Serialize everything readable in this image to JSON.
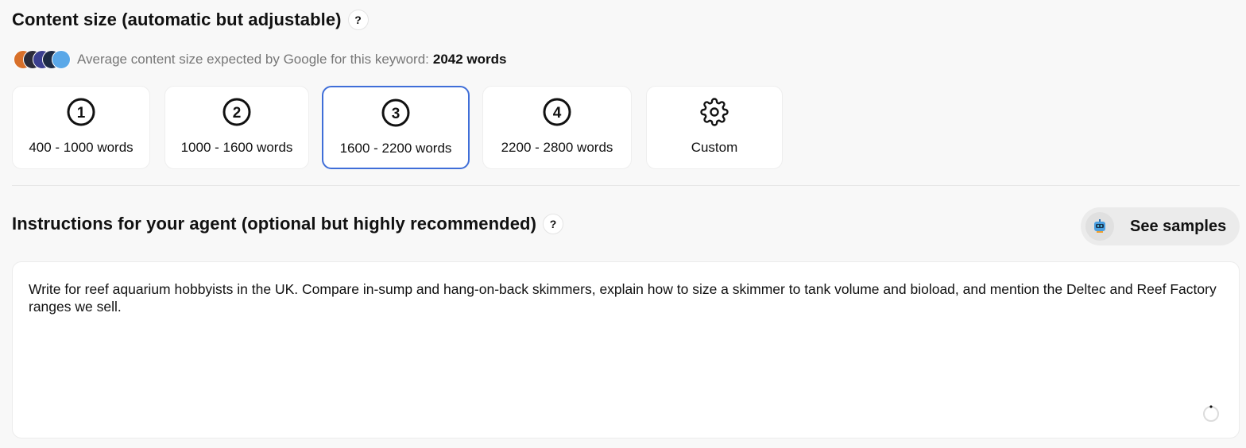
{
  "content_size": {
    "title": "Content size (automatic but adjustable)",
    "help_label": "?",
    "avg_text": "Average content size expected by Google for this keyword:",
    "avg_value": "2042 words",
    "competitor_icons": [
      "competitor-avatar",
      "competitor-avatar",
      "competitor-avatar",
      "competitor-avatar",
      "competitor-avatar"
    ],
    "options": [
      {
        "number": "1",
        "label": "400 - 1000 words",
        "selected": false
      },
      {
        "number": "2",
        "label": "1000 - 1600 words",
        "selected": false
      },
      {
        "number": "3",
        "label": "1600 - 2200 words",
        "selected": true
      },
      {
        "number": "4",
        "label": "2200 - 2800 words",
        "selected": false
      },
      {
        "number": "",
        "label": "Custom",
        "icon": "gear-icon",
        "selected": false
      }
    ]
  },
  "instructions": {
    "title": "Instructions for your agent (optional but highly recommended)",
    "help_label": "?",
    "samples_button": "See samples",
    "text": "Write for reef aquarium hobbyists in the UK. Compare in-sump and hang-on-back skimmers, explain how to size a skimmer to tank volume and bioload, and mention the Deltec and Reef Factory ranges we sell."
  },
  "colors": {
    "accent": "#3f6ed8",
    "background": "#f8f8f8"
  }
}
